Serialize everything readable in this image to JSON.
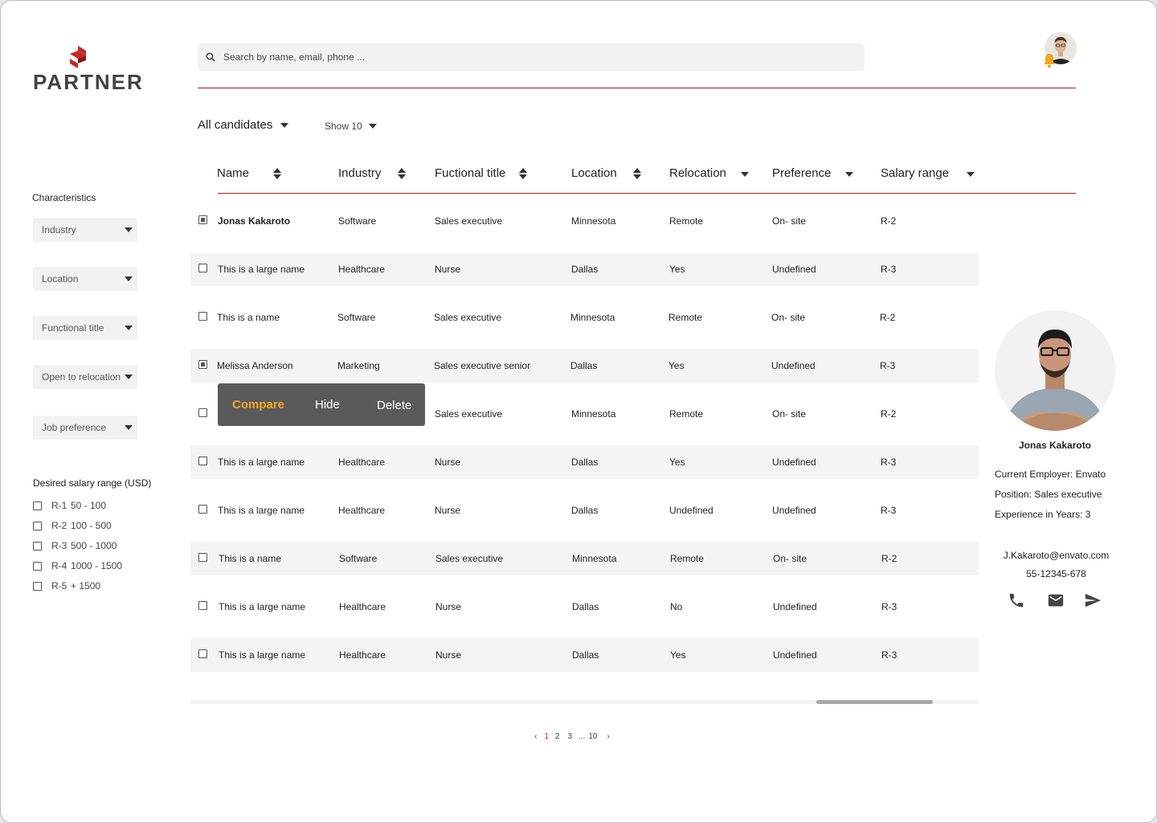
{
  "brand": {
    "name": "PARTNER",
    "accent": "#c62828"
  },
  "search": {
    "placeholder": "Search by name, email, phone ..."
  },
  "filters": {
    "all_candidates": "All candidates",
    "show": "Show 10"
  },
  "sidebar": {
    "characteristics_title": "Characteristics",
    "dropdowns": [
      "Industry",
      "Location",
      "Functional title",
      "Open to relocation",
      "Job preference"
    ],
    "salary_title": "Desired salary range (USD)",
    "salary_options": [
      {
        "code": "R-1",
        "range": "50 - 100"
      },
      {
        "code": "R-2",
        "range": "100 - 500"
      },
      {
        "code": "R-3",
        "range": "500 - 1000"
      },
      {
        "code": "R-4",
        "range": "1000 - 1500"
      },
      {
        "code": "R-5",
        "range": "+ 1500"
      }
    ]
  },
  "table": {
    "headers": [
      "Name",
      "Industry",
      "Fuctional title",
      "Location",
      "Relocation",
      "Preference",
      "Salary range"
    ],
    "rows": [
      {
        "checked": true,
        "name": "Jonas Kakaroto",
        "industry": "Software",
        "title": "Sales executive",
        "location": "Minnesota",
        "relocation": "Remote",
        "preference": "On- site",
        "salary": "R-2"
      },
      {
        "checked": false,
        "name": "This is a large name",
        "industry": "Healthcare",
        "title": "Nurse",
        "location": "Dallas",
        "relocation": "Yes",
        "preference": "Undefined",
        "salary": "R-3"
      },
      {
        "checked": false,
        "name": "This is a name",
        "industry": "Software",
        "title": "Sales executive",
        "location": "Minnesota",
        "relocation": "Remote",
        "preference": "On- site",
        "salary": "R-2"
      },
      {
        "checked": true,
        "name": "Melissa Anderson",
        "industry": "Marketing",
        "title": "Sales executive senior",
        "location": "Dallas",
        "relocation": "Yes",
        "preference": "Undefined",
        "salary": "R-3"
      },
      {
        "checked": false,
        "name": "",
        "industry": "",
        "title": "Sales executive",
        "location": "Minnesota",
        "relocation": "Remote",
        "preference": "On- site",
        "salary": "R-2"
      },
      {
        "checked": false,
        "name": "This is a large name",
        "industry": "Healthcare",
        "title": "Nurse",
        "location": "Dallas",
        "relocation": "Yes",
        "preference": "Undefined",
        "salary": "R-3"
      },
      {
        "checked": false,
        "name": "This is a large name",
        "industry": "Healthcare",
        "title": "Nurse",
        "location": "Dallas",
        "relocation": "Undefined",
        "preference": "Undefined",
        "salary": "R-3"
      },
      {
        "checked": false,
        "name": "This is a name",
        "industry": "Software",
        "title": "Sales executive",
        "location": "Minnesota",
        "relocation": "Remote",
        "preference": "On- site",
        "salary": "R-2"
      },
      {
        "checked": false,
        "name": "This is a large name",
        "industry": "Healthcare",
        "title": "Nurse",
        "location": "Dallas",
        "relocation": "No",
        "preference": "Undefined",
        "salary": "R-3"
      },
      {
        "checked": false,
        "name": "This is a large name",
        "industry": "Healthcare",
        "title": "Nurse",
        "location": "Dallas",
        "relocation": "Yes",
        "preference": "Undefined",
        "salary": "R-3"
      }
    ]
  },
  "popup": {
    "compare": "Compare",
    "hide": "Hide",
    "delete": "Delete",
    "accent": "#f5a623"
  },
  "pagination": {
    "prev": "‹",
    "pages": [
      "1",
      "2",
      "3",
      "...",
      "10"
    ],
    "next": "›",
    "active": "1"
  },
  "profile": {
    "name": "Jonas Kakaroto",
    "employer": "Current Employer: Envato",
    "position": "Position: Sales executive",
    "experience": "Experience in Years: 3",
    "email": "J.Kakaroto@envato.com",
    "phone": "55-12345-678",
    "icons": [
      "phone-icon",
      "email-icon",
      "send-icon"
    ]
  }
}
